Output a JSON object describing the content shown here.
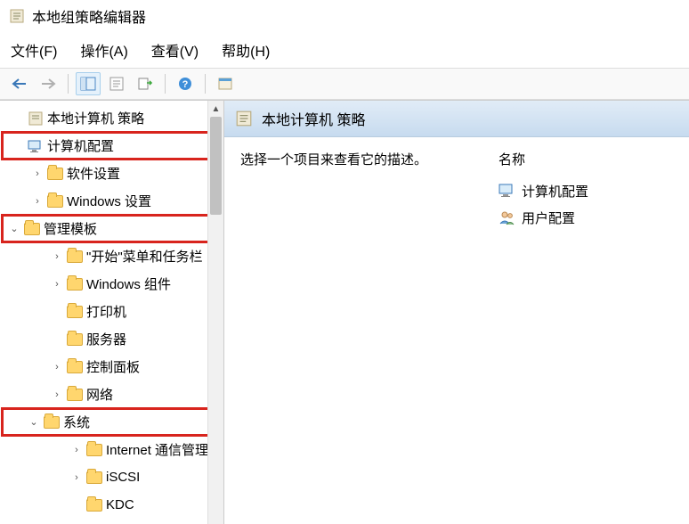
{
  "window": {
    "title": "本地组策略编辑器"
  },
  "menu": {
    "file": "文件(F)",
    "action": "操作(A)",
    "view": "查看(V)",
    "help": "帮助(H)"
  },
  "tree": {
    "root": "本地计算机 策略",
    "computer_config": "计算机配置",
    "software_settings": "软件设置",
    "windows_settings": "Windows 设置",
    "admin_templates": "管理模板",
    "start_menu": "\"开始\"菜单和任务栏",
    "windows_components": "Windows 组件",
    "printers": "打印机",
    "servers": "服务器",
    "control_panel": "控制面板",
    "network": "网络",
    "system": "系统",
    "internet": "Internet 通信管理",
    "iscsi": "iSCSI",
    "kdc": "KDC"
  },
  "content": {
    "header": "本地计算机 策略",
    "description": "选择一个项目来查看它的描述。",
    "name_col": "名称",
    "items": {
      "computer": "计算机配置",
      "user": "用户配置"
    }
  }
}
